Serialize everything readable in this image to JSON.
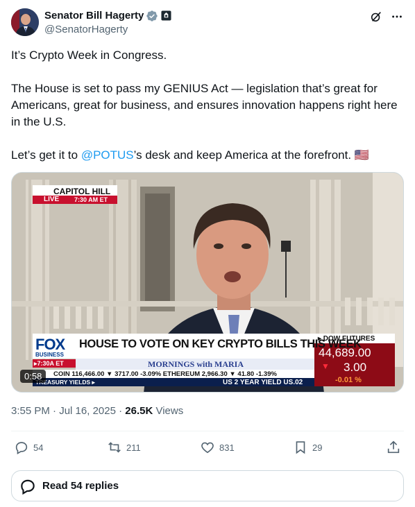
{
  "author": {
    "name": "Senator Bill Hagerty",
    "handle": "@SenatorHagerty"
  },
  "tweet": {
    "line1": "It’s Crypto Week in Congress.",
    "line2": "The House is set to pass my GENIUS Act — legislation that’s great for Americans, great for business, and ensures innovation happens right here in the U.S.",
    "line3_before": "Let’s get it to ",
    "line3_mention": "@POTUS",
    "line3_after": "’s desk and keep America at the forefront. 🇺🇸"
  },
  "video": {
    "duration": "0:58",
    "location": "CAPITOL HILL",
    "live": "LIVE",
    "live_time": "7:30 AM ET",
    "network": "FOX",
    "network_sub": "BUSINESS",
    "air_time": "▸7:30A ET",
    "headline": "HOUSE TO VOTE ON KEY CRYPTO BILLS THIS WEEK",
    "show": "MORNINGS with MARIA",
    "ticker1": "COIN  116,466.00 ▼ 3717.00 -3.09%  ETHEREUM  2,966.30 ▼ 41.80 -1.39%",
    "ticker2_left": "TREASURY YIELDS ▸",
    "ticker2_right": "US 2 YEAR YIELD  US.02",
    "dow_label": "▸ DOW FUTURES",
    "dow_value": "44,689.00",
    "dow_change": "3.00",
    "dow_pct": "-0.01 %"
  },
  "meta": {
    "time": "3:55 PM",
    "separator": " · ",
    "date": "Jul 16, 2025",
    "views_count": "26.5K",
    "views_label": " Views"
  },
  "actions": {
    "replies": "54",
    "reposts": "211",
    "likes": "831",
    "bookmarks": "29"
  },
  "read_replies": "Read 54 replies",
  "colors": {
    "accent": "#1d9bf0",
    "text": "#0f1419",
    "secondary": "#536471",
    "fox_red": "#c8102e",
    "fox_blue": "#003a8c"
  }
}
